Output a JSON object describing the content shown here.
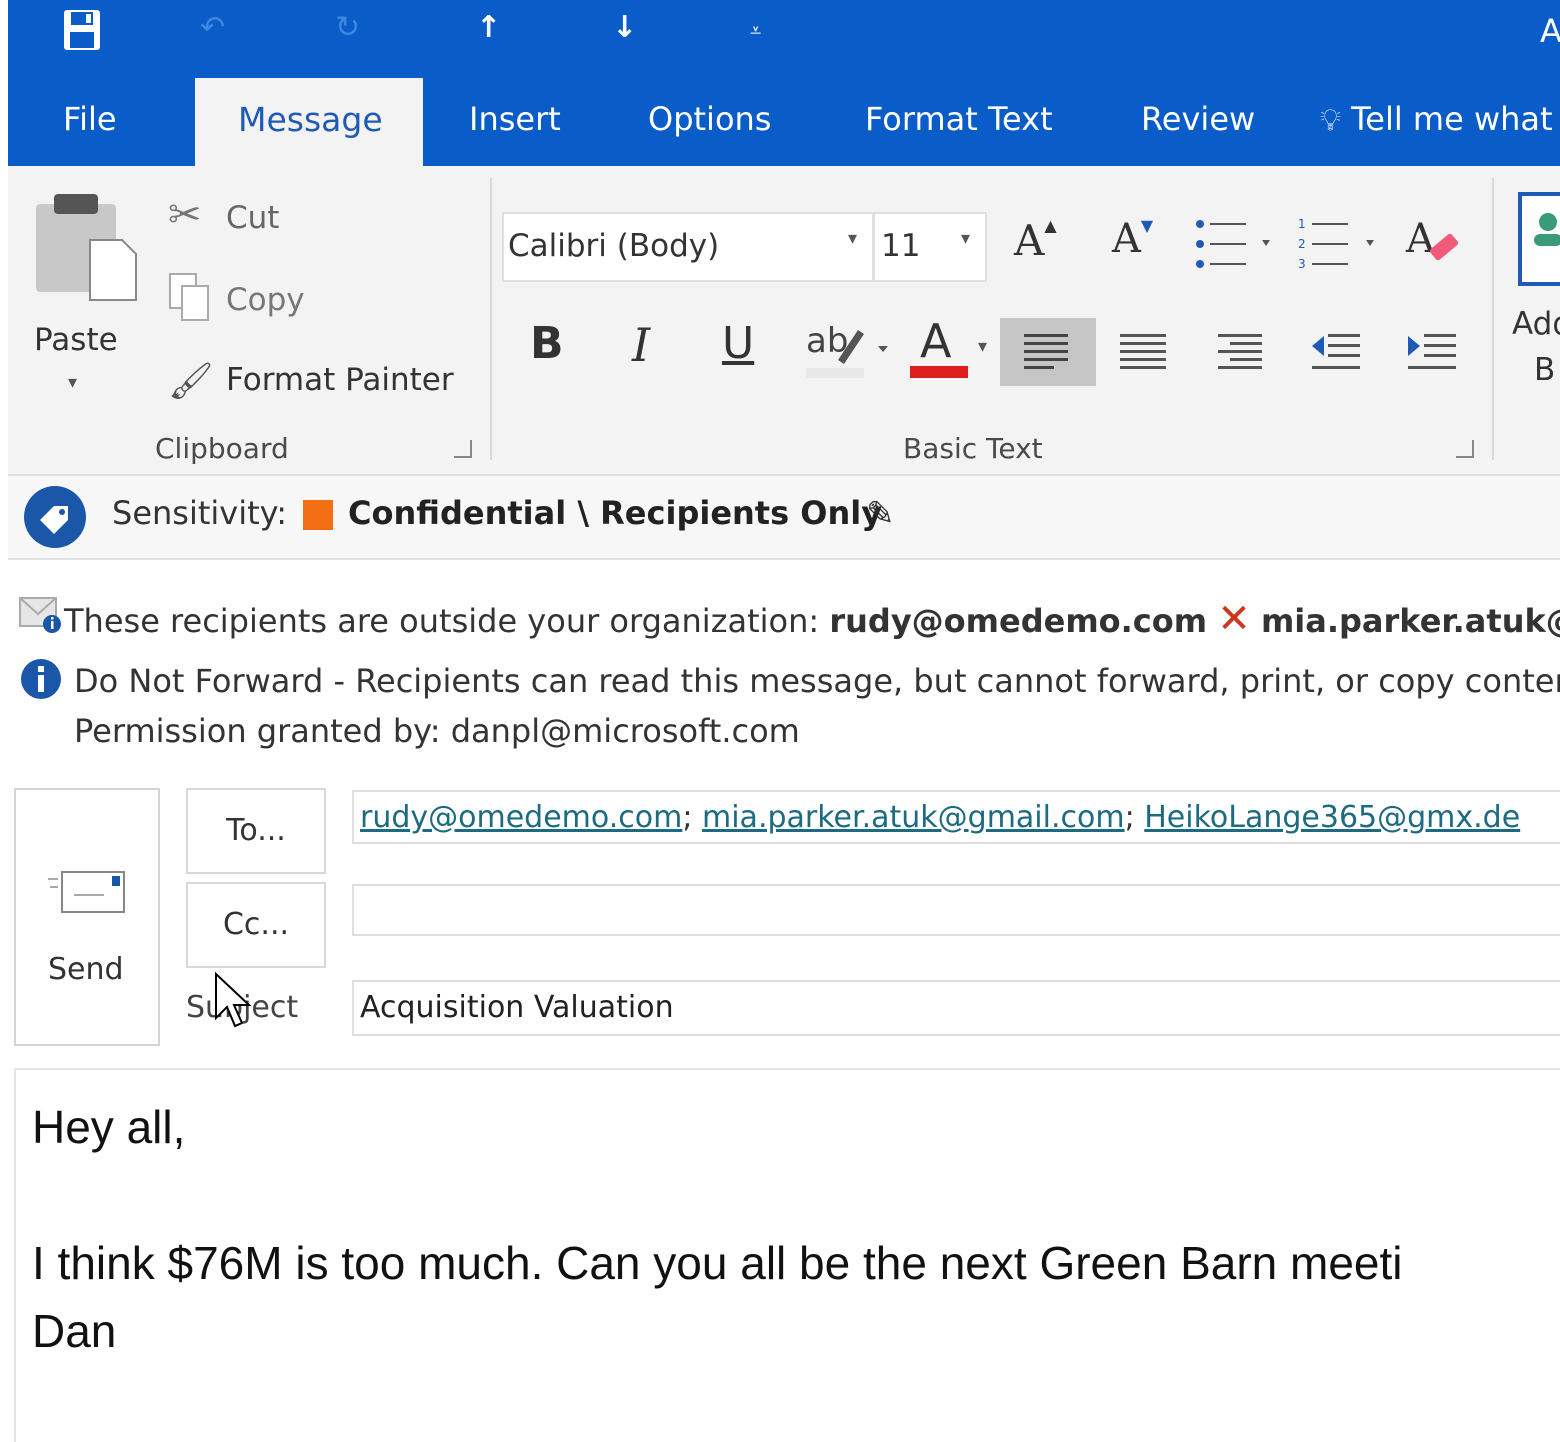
{
  "quick_access": {
    "save_icon": "save-icon",
    "undo_icon": "undo-icon",
    "redo_icon": "redo-icon",
    "previous_icon": "arrow-up-icon",
    "next_icon": "arrow-down-icon",
    "customize_icon": "customize-icon",
    "account_initial": "A"
  },
  "tabs": [
    {
      "label": "File"
    },
    {
      "label": "Message"
    },
    {
      "label": "Insert"
    },
    {
      "label": "Options"
    },
    {
      "label": "Format Text"
    },
    {
      "label": "Review"
    }
  ],
  "tell_me": "Tell me what",
  "ribbon": {
    "clipboard": {
      "paste_label": "Paste",
      "cut_label": "Cut",
      "copy_label": "Copy",
      "format_painter_label": "Format Painter",
      "group_label": "Clipboard"
    },
    "basic_text": {
      "font_name": "Calibri (Body)",
      "font_size": "11",
      "bold": "B",
      "italic": "I",
      "underline": "U",
      "font_color_letter": "A",
      "font_color": "#e01d1d",
      "group_label": "Basic Text"
    },
    "names": {
      "label_line1": "Add",
      "label_line2": "B"
    }
  },
  "sensitivity": {
    "label": "Sensitivity:",
    "value": "Confidential \\ Recipients Only",
    "swatch_color": "#f36f13"
  },
  "mail_tip": {
    "text": "These recipients are outside your organization:",
    "recipient1": "rudy@omedemo.com",
    "recipient2": "mia.parker.atuk@gm"
  },
  "permission": {
    "line1": "Do Not Forward - Recipients can read this message, but cannot forward, print, or copy content.",
    "line2": "Permission granted by: danpl@microsoft.com"
  },
  "compose": {
    "send_label": "Send",
    "to_button": "To...",
    "cc_button": "Cc...",
    "subject_label": "Subject",
    "to_recipients": [
      "rudy@omedemo.com",
      "mia.parker.atuk@gmail.com",
      "HeikoLange365@gmx.de"
    ],
    "separator": ";",
    "cc_value": "",
    "subject_value": "Acquisition Valuation"
  },
  "body": {
    "greeting": "Hey all,",
    "line1": "I think $76M is too much. Can you all be the next Green Barn meeti",
    "signature": "Dan"
  }
}
